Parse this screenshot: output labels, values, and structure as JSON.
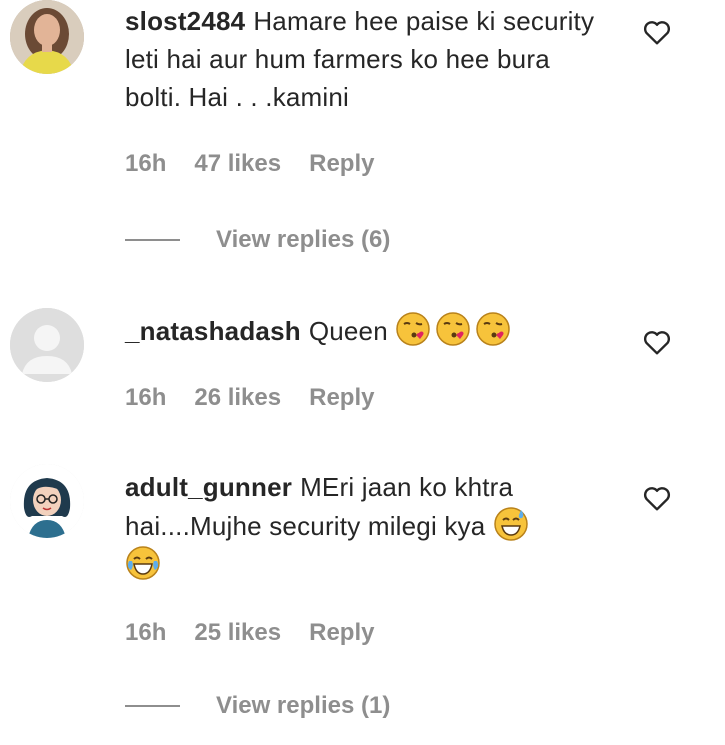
{
  "comments": [
    {
      "username": "slost2484",
      "text": "Hamare hee paise ki security leti hai aur hum farmers ko hee bura bolti. Hai . . .kamini",
      "time": "16h",
      "likes": "47 likes",
      "reply": "Reply",
      "view_replies": "View replies (6)",
      "avatar": "profile-photo"
    },
    {
      "username": "_natashadash",
      "text": "Queen",
      "emojis": [
        "face-blowing-kiss",
        "face-blowing-kiss",
        "face-blowing-kiss"
      ],
      "time": "16h",
      "likes": "26 likes",
      "reply": "Reply",
      "avatar": "default-avatar"
    },
    {
      "username": "adult_gunner",
      "text": "MEri jaan ko khtra hai....Mujhe security milegi kya",
      "emojis": [
        "grinning-face-with-sweat",
        "face-with-tears-of-joy"
      ],
      "time": "16h",
      "likes": "25 likes",
      "reply": "Reply",
      "view_replies": "View replies (1)",
      "avatar": "cartoon-avatar"
    }
  ],
  "colors": {
    "text": "#262626",
    "secondary": "#8e8e8e",
    "background": "#ffffff"
  },
  "icons": {
    "like": "heart-outline-icon"
  }
}
